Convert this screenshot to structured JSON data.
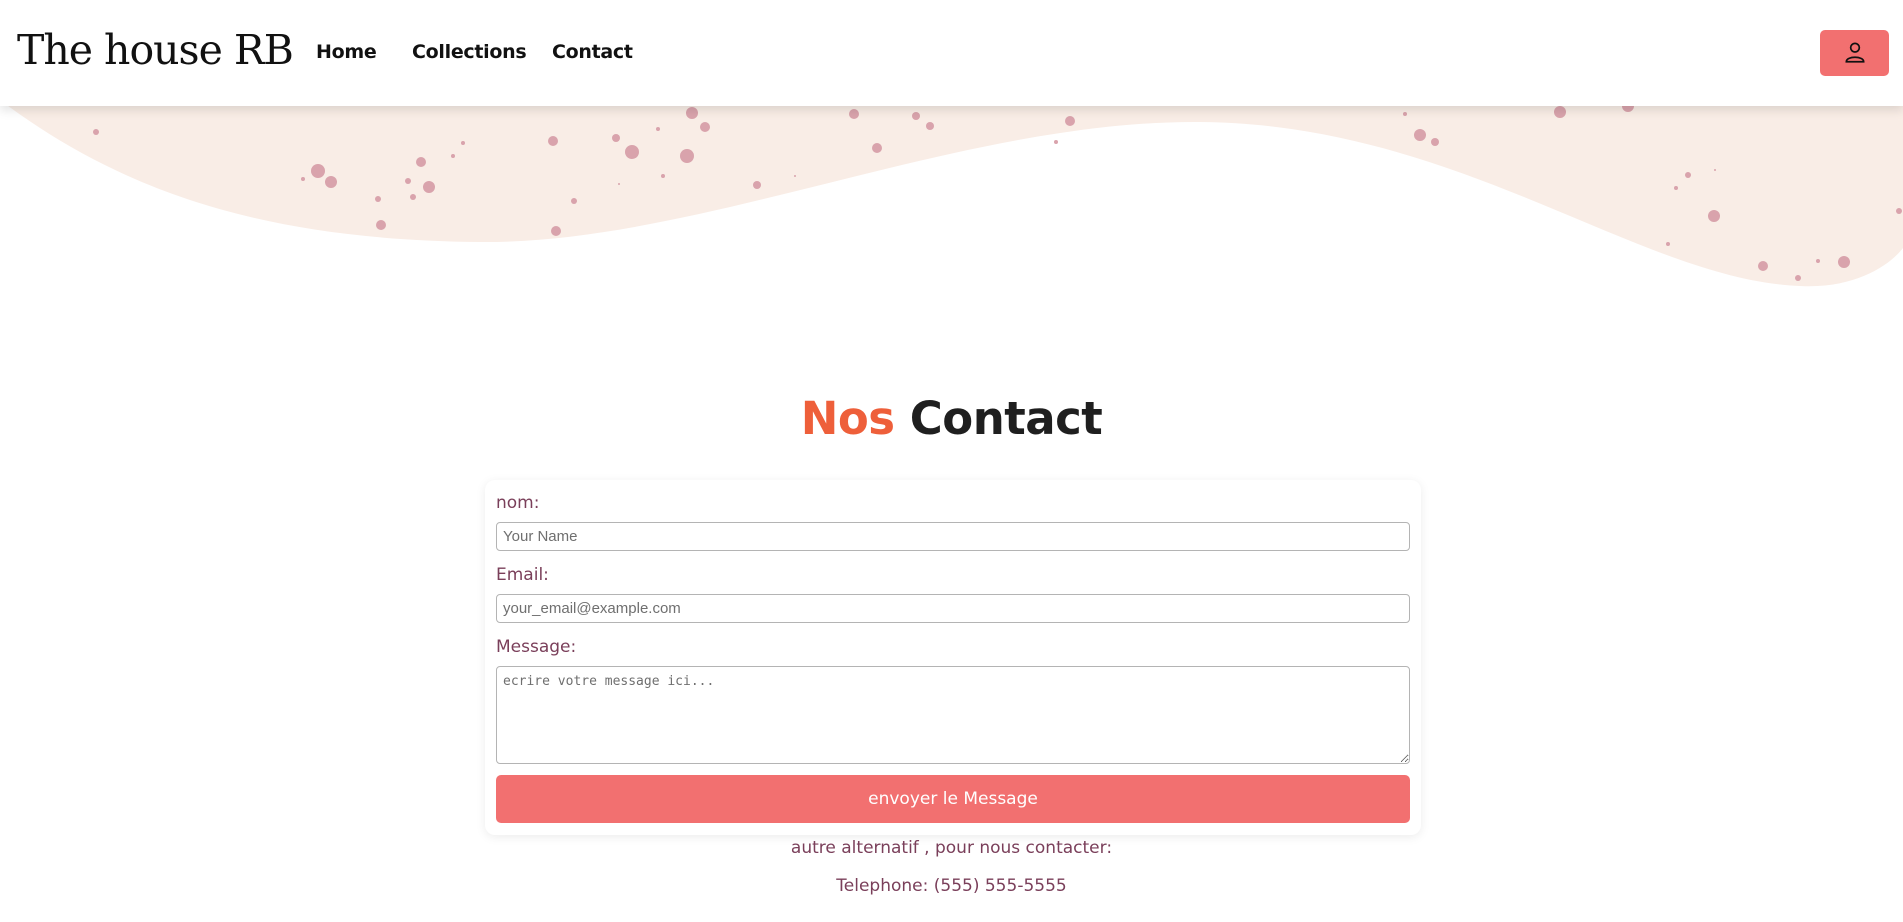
{
  "header": {
    "brand": "The house RB",
    "nav": [
      "Home",
      "Collections",
      "Contact"
    ],
    "user_icon": "user-icon"
  },
  "hero": {
    "colors": {
      "wave": "#f9ede6",
      "dots": "#d9a3ac"
    }
  },
  "page": {
    "title_accent": "Nos",
    "title_rest": "Contact"
  },
  "form": {
    "name_label": "nom:",
    "name_placeholder": "Your Name",
    "email_label": "Email:",
    "email_placeholder": "your_email@example.com",
    "message_label": "Message:",
    "message_placeholder": "ecrire votre message ici...",
    "submit_label": "envoyer le Message"
  },
  "contact_alt": {
    "intro": "autre alternatif , pour nous contacter:",
    "phone": "Telephone: (555) 555-5555"
  },
  "colors": {
    "accent": "#f27070",
    "title_accent": "#ee5f3a",
    "label": "#7a3f5a"
  }
}
